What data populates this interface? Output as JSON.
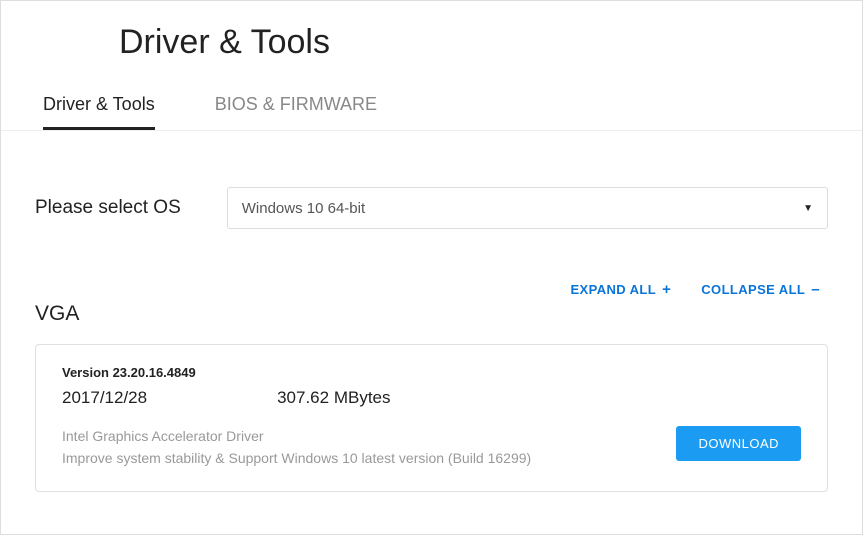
{
  "title": "Driver & Tools",
  "tabs": {
    "driver": "Driver & Tools",
    "bios": "BIOS & FIRMWARE"
  },
  "os": {
    "label": "Please select OS",
    "selected": "Windows 10 64-bit"
  },
  "actions": {
    "expand_all": "EXPAND ALL",
    "collapse_all": "COLLAPSE ALL"
  },
  "section": {
    "title": "VGA",
    "item": {
      "version_label": "Version 23.20.16.4849",
      "date": "2017/12/28",
      "size": "307.62 MBytes",
      "desc_line1": "Intel Graphics Accelerator Driver",
      "desc_line2": "Improve system stability & Support Windows 10 latest version (Build 16299)",
      "download": "DOWNLOAD"
    }
  }
}
